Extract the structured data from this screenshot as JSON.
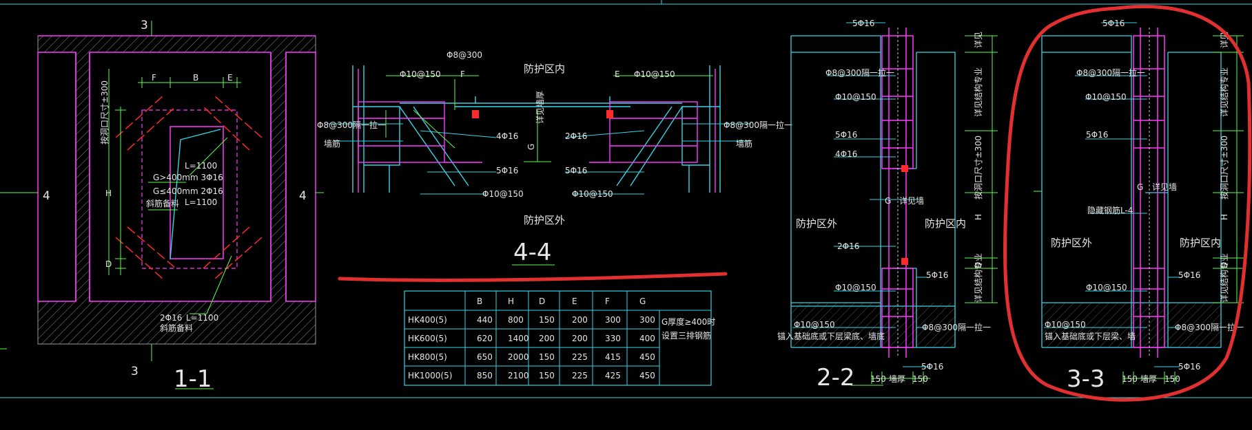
{
  "colors": {
    "bg": "#000000",
    "frame": "#35d6e6",
    "rebar": "#ff39ff",
    "dim": "#5cff4a",
    "text": "#e6e6e6",
    "mark": "#ff2a2a",
    "cut": "#e23030"
  },
  "sec11": {
    "title": "1-1",
    "cut_top": "3",
    "cut_bottom": "3",
    "cut_left": "4",
    "cut_right": "4",
    "dim_F": "F",
    "dim_B": "B",
    "dim_E": "E",
    "dim_H": "H",
    "dim_D": "D",
    "side_dim": "按洞口尺寸±300",
    "note_L1": "L=1100",
    "note_g1": "G>400mm 3Φ16",
    "note_g2": "G≤400mm 2Φ16",
    "note_fa1": "斜筋备料",
    "note_L2": "L=1100",
    "note_bar": "2Φ16",
    "note_L3": "L=1100",
    "note_fa2": "斜筋备料"
  },
  "sec44": {
    "title": "4-4",
    "top": "防护区内",
    "bottom": "防护区外",
    "phi8": "Φ8@300",
    "l_phi10": "Φ10@150",
    "l_F": "F",
    "r_E": "E",
    "r_phi10": "Φ10@150",
    "l_phi8g": "Φ8@300隔一拉一",
    "r_phi8g": "Φ8@300隔一拉一",
    "l_wall": "墙筋",
    "r_wall": "墙筋",
    "l_4": "4Φ16",
    "r_2": "2Φ16",
    "l_5": "5Φ16",
    "r_5": "5Φ16",
    "G": "G",
    "wall_thick": "详见墙厚",
    "l_b10": "Φ10@150",
    "r_b10": "Φ10@150"
  },
  "table": {
    "headers": [
      "",
      "B",
      "H",
      "D",
      "E",
      "F",
      "G"
    ],
    "rows": [
      [
        "HK400(5)",
        "440",
        "800",
        "150",
        "200",
        "300",
        "300"
      ],
      [
        "HK600(5)",
        "620",
        "1400",
        "200",
        "200",
        "330",
        "400"
      ],
      [
        "HK800(5)",
        "650",
        "2000",
        "150",
        "225",
        "415",
        "450"
      ],
      [
        "HK1000(5)",
        "850",
        "2100",
        "150",
        "225",
        "425",
        "450"
      ]
    ],
    "note1": "G厚度≥400时",
    "note2": "设置三排钢筋"
  },
  "sec22": {
    "title": "2-2",
    "top": "5Φ16",
    "phi8": "Φ8@300隔一拉一",
    "phi10": "Φ10@150",
    "b5": "5Φ16",
    "b4": "4Φ16",
    "G": "G",
    "wall": "详见墙",
    "outside": "防护区外",
    "inside": "防护区内",
    "b2": "2Φ16",
    "b5r": "5Φ16",
    "phi10b": "Φ10@150",
    "phi10c": "Φ10@150",
    "anchor": "锚入基础底或下层梁底、墙底",
    "phi8b": "Φ8@300隔一拉一",
    "bot5": "5Φ16",
    "d150a": "150",
    "wallw": "墙厚",
    "d150b": "150",
    "rd1": "详见",
    "rd2": "详见结构专业",
    "rd3": "按洞口尺寸±300",
    "rd4": "H",
    "rd5": "D",
    "rd6": "详见结构专业"
  },
  "sec33": {
    "title": "3-3",
    "top": "5Φ16",
    "phi8": "Φ8@300隔一拉一",
    "phi10": "Φ10@150",
    "b5": "5Φ16",
    "G": "G",
    "wall": "详见墙",
    "hidden": "隐藏钢筋L-4",
    "outside": "防护区外",
    "inside": "防护区内",
    "phi10b": "Φ10@150",
    "b5r": "5Φ16",
    "phi10c": "Φ10@150",
    "anchor": "锚入基础底或下层梁、墙",
    "phi8b": "Φ8@300隔一拉一",
    "bot5": "5Φ16",
    "d150a": "150",
    "wallw": "墙厚",
    "d150b": "150",
    "rd1": "详见",
    "rd2": "详见结构专业",
    "rd3": "按洞口尺寸±300",
    "rd4": "H",
    "rd5": "D",
    "rd6": "详见结构专业"
  }
}
